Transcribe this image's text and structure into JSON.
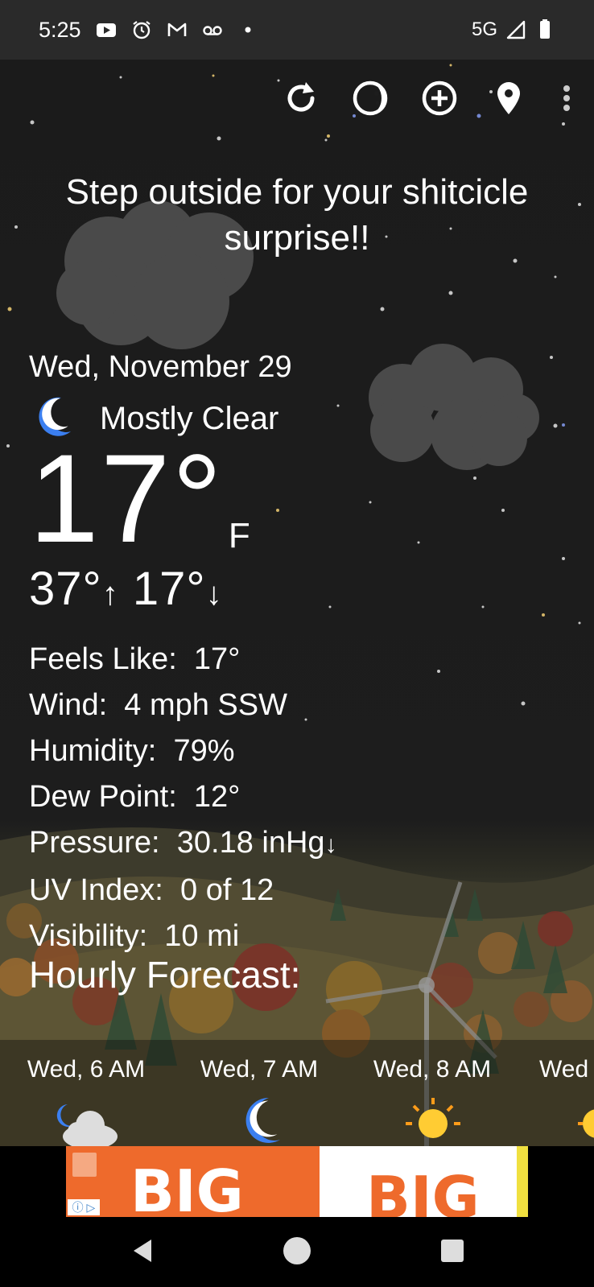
{
  "status_bar": {
    "time": "5:25",
    "network": "5G",
    "left_icons": [
      "youtube-icon",
      "alarm-icon",
      "gmail-icon",
      "voicemail-icon",
      "dot-icon"
    ],
    "right_icons": [
      "signal-icon",
      "battery-icon"
    ]
  },
  "toolbar": {
    "icons": [
      "refresh-icon",
      "theme-icon",
      "add-location-icon",
      "location-pin-icon",
      "more-vert-icon"
    ]
  },
  "message": "Step outside for your shitcicle surprise!!",
  "weather": {
    "date": "Wed, November 29",
    "condition": "Mostly Clear",
    "temperature": "17°",
    "unit": "F",
    "high": "37°",
    "low": "17°",
    "details": [
      {
        "label": "Feels Like:",
        "value": "17°"
      },
      {
        "label": "Wind:",
        "value": "4 mph SSW"
      },
      {
        "label": "Humidity:",
        "value": "79%"
      },
      {
        "label": "Dew Point:",
        "value": "12°"
      },
      {
        "label": "Pressure:",
        "value": "30.18 inHg"
      },
      {
        "label": "UV Index:",
        "value": "0 of 12"
      },
      {
        "label": "Visibility:",
        "value": "10 mi"
      }
    ]
  },
  "hourly": {
    "title": "Hourly Forecast:",
    "items": [
      {
        "time": "Wed, 6 AM",
        "icon": "moon-cloud-icon"
      },
      {
        "time": "Wed, 7 AM",
        "icon": "moon-icon"
      },
      {
        "time": "Wed, 8 AM",
        "icon": "sun-icon"
      },
      {
        "time": "Wed",
        "icon": "sun-icon"
      }
    ]
  },
  "ad": {
    "word": "BIG",
    "info_label": "ⓘ ▷"
  },
  "colors": {
    "accent_blue": "#3b7ff0",
    "sun_yellow": "#ffcc33",
    "ad_orange": "#ee6a2c"
  }
}
